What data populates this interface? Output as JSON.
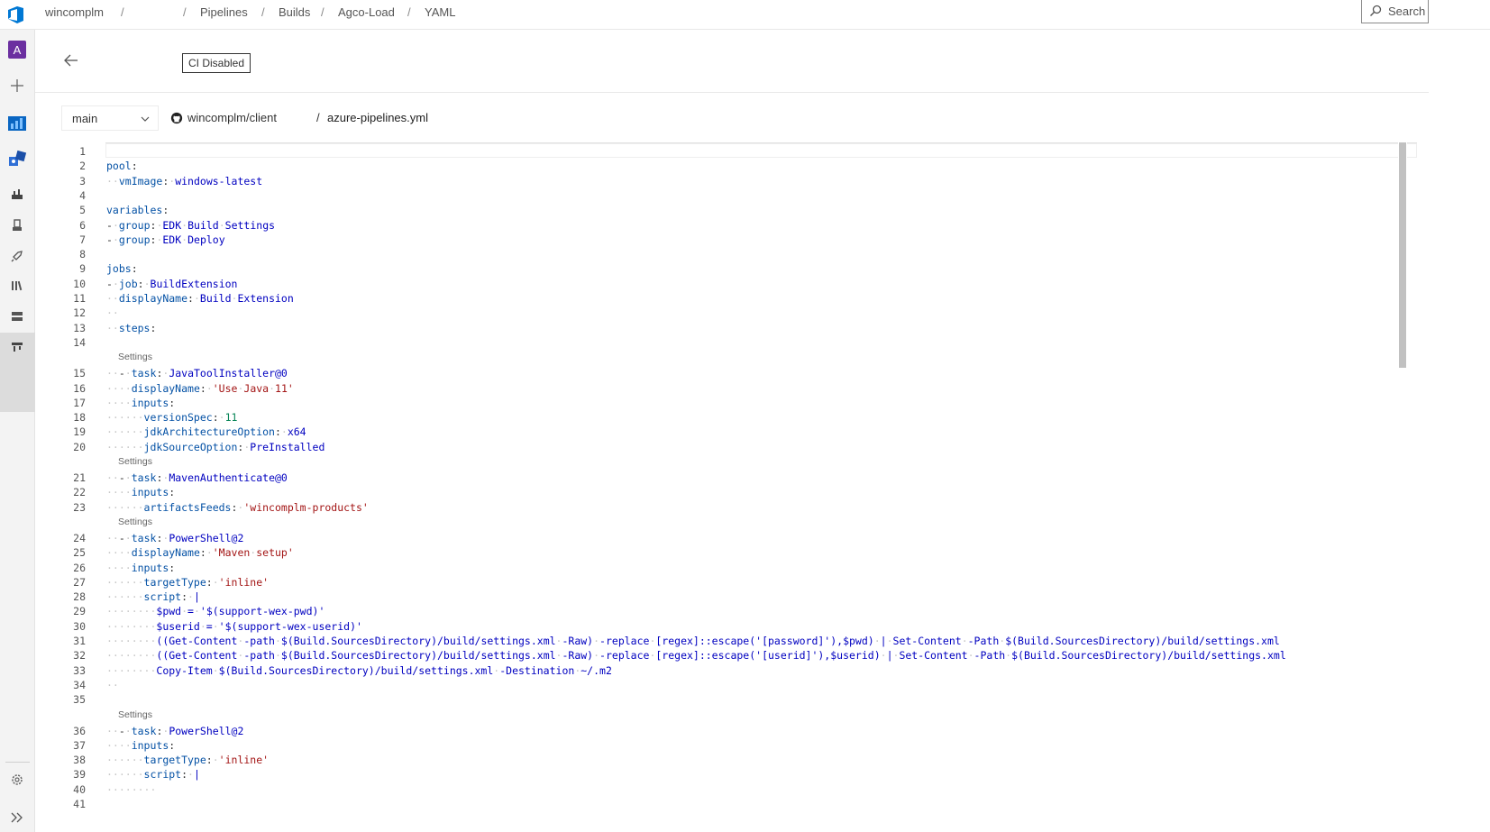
{
  "breadcrumb": {
    "org": "wincomplm",
    "project": "",
    "items": [
      "Pipelines",
      "Builds",
      "Agco-Load",
      "YAML"
    ],
    "separator": "/"
  },
  "search": {
    "label": "Search"
  },
  "header": {
    "pipeline_name": "",
    "ci_badge": "CI Disabled"
  },
  "file_bar": {
    "branch": "main",
    "repo": "wincomplm/client",
    "separator": "/",
    "file": "azure-pipelines.yml"
  },
  "editor": {
    "codelens_label": "Settings",
    "lines": [
      {
        "n": "1",
        "t": ""
      },
      {
        "n": "2",
        "t": "pool:"
      },
      {
        "n": "3",
        "t": "  vmImage: windows-latest"
      },
      {
        "n": "4",
        "t": ""
      },
      {
        "n": "5",
        "t": "variables:"
      },
      {
        "n": "6",
        "t": "- group: EDK Build Settings"
      },
      {
        "n": "7",
        "t": "- group: EDK Deploy"
      },
      {
        "n": "8",
        "t": ""
      },
      {
        "n": "9",
        "t": "jobs:"
      },
      {
        "n": "10",
        "t": "- job: BuildExtension"
      },
      {
        "n": "11",
        "t": "  displayName: Build Extension"
      },
      {
        "n": "12",
        "t": "  "
      },
      {
        "n": "13",
        "t": "  steps:"
      },
      {
        "n": "14",
        "t": ""
      },
      {
        "n": "15",
        "t": "  - task: JavaToolInstaller@0",
        "lens": true
      },
      {
        "n": "16",
        "t": "    displayName: 'Use Java 11'"
      },
      {
        "n": "17",
        "t": "    inputs:"
      },
      {
        "n": "18",
        "t": "      versionSpec: 11"
      },
      {
        "n": "19",
        "t": "      jdkArchitectureOption: x64"
      },
      {
        "n": "20",
        "t": "      jdkSourceOption: PreInstalled"
      },
      {
        "n": "21",
        "t": "  - task: MavenAuthenticate@0",
        "lens": true
      },
      {
        "n": "22",
        "t": "    inputs:"
      },
      {
        "n": "23",
        "t": "      artifactsFeeds: 'wincomplm-products'"
      },
      {
        "n": "24",
        "t": "  - task: PowerShell@2",
        "lens": true
      },
      {
        "n": "25",
        "t": "    displayName: 'Maven setup'"
      },
      {
        "n": "26",
        "t": "    inputs:"
      },
      {
        "n": "27",
        "t": "      targetType: 'inline'"
      },
      {
        "n": "28",
        "t": "      script: |"
      },
      {
        "n": "29",
        "t": "        $pwd = '$(support-wex-pwd)'"
      },
      {
        "n": "30",
        "t": "        $userid = '$(support-wex-userid)'"
      },
      {
        "n": "31",
        "t": "        ((Get-Content -path $(Build.SourcesDirectory)/build/settings.xml -Raw) -replace [regex]::escape('[password]'),$pwd) | Set-Content -Path $(Build.SourcesDirectory)/build/settings.xml"
      },
      {
        "n": "32",
        "t": "        ((Get-Content -path $(Build.SourcesDirectory)/build/settings.xml -Raw) -replace [regex]::escape('[userid]'),$userid) | Set-Content -Path $(Build.SourcesDirectory)/build/settings.xml"
      },
      {
        "n": "33",
        "t": "        Copy-Item $(Build.SourcesDirectory)/build/settings.xml -Destination ~/.m2"
      },
      {
        "n": "34",
        "t": "  "
      },
      {
        "n": "35",
        "t": ""
      },
      {
        "n": "36",
        "t": "  - task: PowerShell@2",
        "lens": true
      },
      {
        "n": "37",
        "t": "    inputs:"
      },
      {
        "n": "38",
        "t": "      targetType: 'inline'"
      },
      {
        "n": "39",
        "t": "      script: |"
      },
      {
        "n": "40",
        "t": "        "
      },
      {
        "n": "41",
        "t": ""
      }
    ]
  }
}
